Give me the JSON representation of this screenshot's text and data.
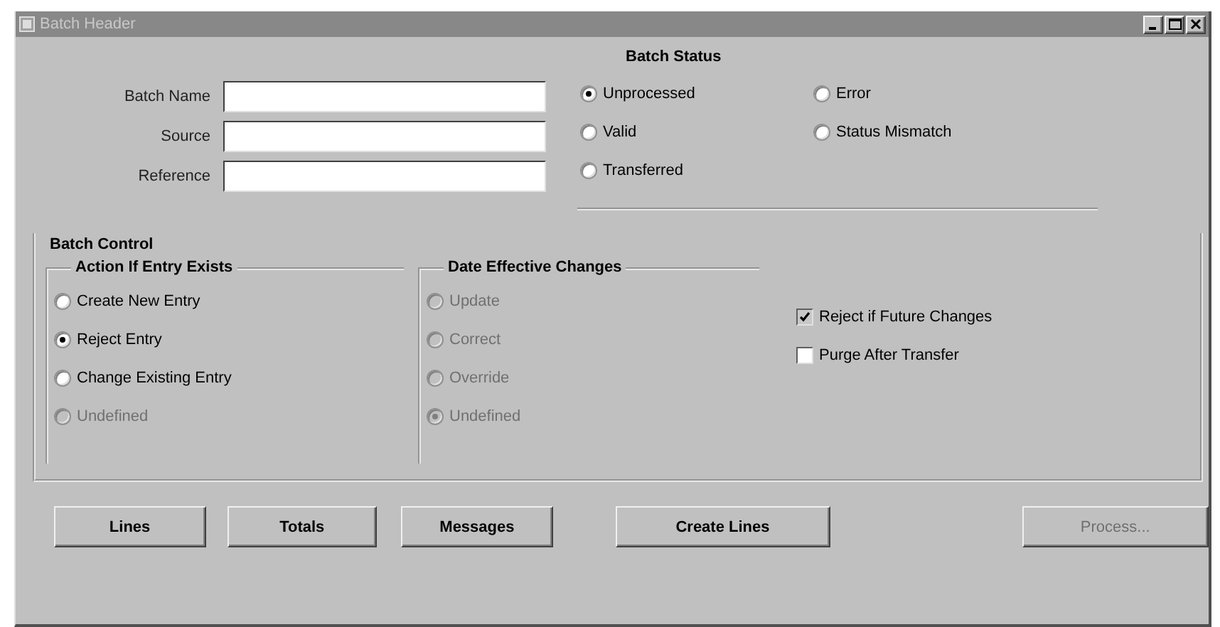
{
  "window": {
    "title": "Batch Header"
  },
  "fields": [
    {
      "label": "Batch Name"
    },
    {
      "label": "Source"
    },
    {
      "label": "Reference"
    }
  ],
  "batch_status": {
    "title": "Batch Status",
    "options": [
      {
        "label": "Unprocessed",
        "selected": true
      },
      {
        "label": "Valid",
        "selected": false
      },
      {
        "label": "Transferred",
        "selected": false
      },
      {
        "label": "Error",
        "selected": false
      },
      {
        "label": "Status Mismatch",
        "selected": false
      }
    ]
  },
  "batch_control": {
    "title": "Batch Control",
    "groups": [
      {
        "title": "Action If Entry Exists",
        "options": [
          {
            "label": "Create New Entry",
            "selected": false,
            "disabled": false
          },
          {
            "label": "Reject Entry",
            "selected": true,
            "disabled": false
          },
          {
            "label": "Change Existing Entry",
            "selected": false,
            "disabled": false
          },
          {
            "label": "Undefined",
            "selected": false,
            "disabled": true
          }
        ]
      },
      {
        "title": "Date Effective Changes",
        "options": [
          {
            "label": "Update",
            "selected": false,
            "disabled": true
          },
          {
            "label": "Correct",
            "selected": false,
            "disabled": true
          },
          {
            "label": "Override",
            "selected": false,
            "disabled": true
          },
          {
            "label": "Undefined",
            "selected": true,
            "disabled": true
          }
        ]
      }
    ],
    "checkboxes": [
      {
        "label": "Reject if Future Changes",
        "checked": true
      },
      {
        "label": "Purge After Transfer",
        "checked": false
      }
    ]
  },
  "buttons": [
    {
      "label": "Lines",
      "disabled": false
    },
    {
      "label": "Totals",
      "disabled": false
    },
    {
      "label": "Messages",
      "disabled": false
    },
    {
      "label": "Create Lines",
      "disabled": false
    },
    {
      "label": "Process...",
      "disabled": true
    }
  ]
}
